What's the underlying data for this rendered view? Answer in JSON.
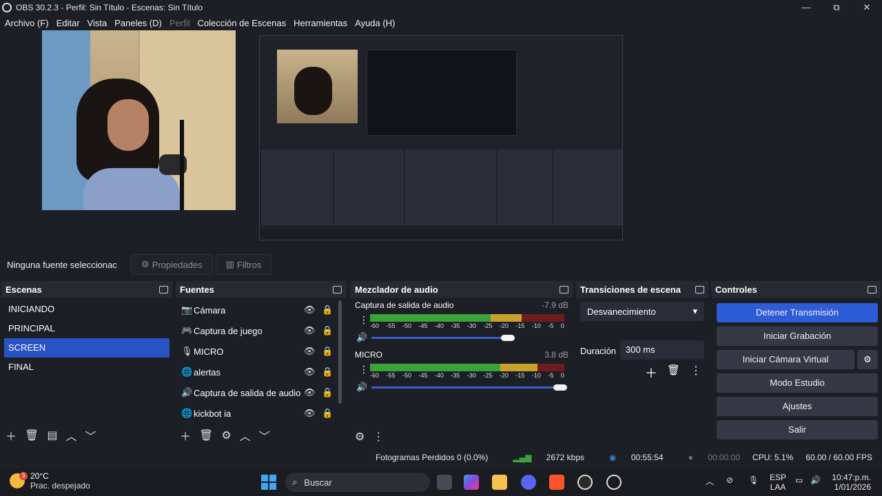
{
  "window": {
    "title": "OBS 30.2.3 - Perfil: Sin Título - Escenas: Sin Título",
    "controls": [
      "—",
      "⧉",
      "✕"
    ]
  },
  "menu": {
    "archivo": "Archivo (F)",
    "editar": "Editar",
    "vista": "Vista",
    "paneles": "Paneles (D)",
    "perfil": "Perfil",
    "coleccion": "Colección de Escenas",
    "herramientas": "Herramientas",
    "ayuda": "Ayuda (H)"
  },
  "toolbar": {
    "no_selection": "Ninguna fuente seleccionac",
    "properties": "Propiedades",
    "filters": "Filtros"
  },
  "scenes": {
    "title": "Escenas",
    "items": [
      "INICIANDO",
      "PRINCIPAL",
      "SCREEN",
      "FINAL"
    ],
    "selected": "SCREEN"
  },
  "sources": {
    "title": "Fuentes",
    "items": [
      {
        "label": "Cámara",
        "icon": "camera-icon"
      },
      {
        "label": "Captura de juego",
        "icon": "gamepad-icon"
      },
      {
        "label": "MICRO",
        "icon": "microphone-icon"
      },
      {
        "label": "alertas",
        "icon": "browser-icon"
      },
      {
        "label": "Captura de salida de audio",
        "icon": "speaker-icon"
      },
      {
        "label": "kickbot ia",
        "icon": "browser-icon"
      }
    ]
  },
  "mixer": {
    "title": "Mezclador de audio",
    "ticks": [
      "-60",
      "-55",
      "-50",
      "-45",
      "-40",
      "-35",
      "-30",
      "-25",
      "-20",
      "-15",
      "-10",
      "-5",
      "0"
    ],
    "channels": [
      {
        "name": "Captura de salida de audio",
        "db": "-7.9 dB",
        "level": 0.78,
        "volume": 0.68
      },
      {
        "name": "MICRO",
        "db": "3.8 dB",
        "level": 0.86,
        "volume": 0.95
      }
    ]
  },
  "transitions": {
    "title": "Transiciones de escena",
    "selected": "Desvanecimiento",
    "duration_label": "Duración",
    "duration_value": "300 ms"
  },
  "controls": {
    "title": "Controles",
    "stop_stream": "Detener Transmisión",
    "start_recording": "Iniciar Grabación",
    "start_virtual_cam": "Iniciar Cámara Virtual",
    "studio_mode": "Modo Estudio",
    "settings": "Ajustes",
    "exit": "Salir"
  },
  "status": {
    "dropped_frames": "Fotogramas Perdidos 0 (0.0%)",
    "bitrate": "2672 kbps",
    "stream_time": "00:55:54",
    "record_time": "00:00:00",
    "cpu": "CPU: 5.1%",
    "fps": "60.00 / 60.00 FPS"
  },
  "taskbar": {
    "weather_badge": "3",
    "temp": "20°C",
    "condition": "Prac. despejado",
    "search": "Buscar",
    "lang": "ESP",
    "lang2": "LAA",
    "time": "10:47:p.m.",
    "date": "1/01/2026"
  },
  "colors": {
    "accent": "#2e5bd6",
    "panel": "#272a33",
    "background": "#1d1f26"
  }
}
